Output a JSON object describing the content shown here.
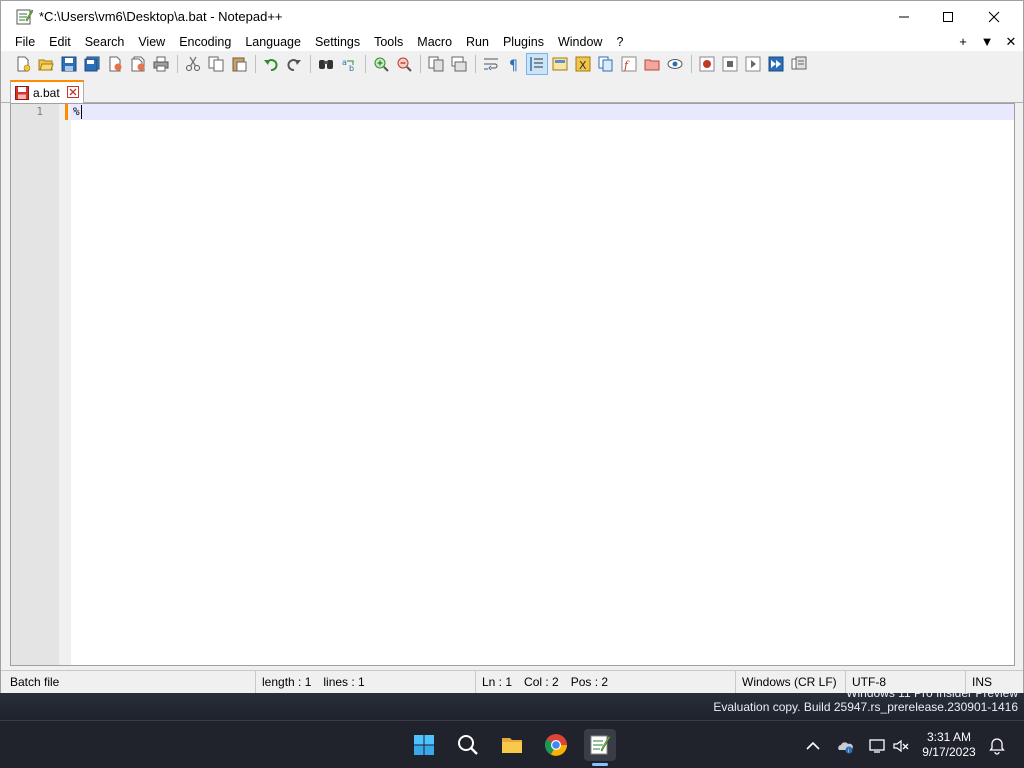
{
  "window": {
    "title": "*C:\\Users\\vm6\\Desktop\\a.bat - Notepad++",
    "controls": {
      "minimize": "─",
      "maximize": "☐",
      "close": "✕"
    }
  },
  "menubar": {
    "items": [
      "File",
      "Edit",
      "Search",
      "View",
      "Encoding",
      "Language",
      "Settings",
      "Tools",
      "Macro",
      "Run",
      "Plugins",
      "Window",
      "?"
    ],
    "right": [
      "+",
      "▼",
      "✕"
    ]
  },
  "tabs": [
    {
      "label": "a.bat",
      "modified": true,
      "active": true
    }
  ],
  "editor": {
    "lines": [
      {
        "number": "1",
        "text": "%"
      }
    ]
  },
  "statusbar": {
    "file_type": "Batch file",
    "length": "length : 1",
    "lines": "lines : 1",
    "ln": "Ln : 1",
    "col": "Col : 2",
    "pos": "Pos : 2",
    "eol": "Windows (CR LF)",
    "encoding": "UTF-8",
    "mode": "INS"
  },
  "watermark": {
    "line1": "Windows 11 Pro Insider Preview",
    "line2": "Evaluation copy. Build 25947.rs_prerelease.230901-1416"
  },
  "taskbar": {
    "apps": [
      "start-icon",
      "search-icon",
      "file-explorer-icon",
      "chrome-icon",
      "notepadpp-icon"
    ],
    "tray": [
      "chevron-up-icon",
      "onedrive-icon",
      "network-icon",
      "volume-muted-icon",
      "notification-icon"
    ],
    "time": "3:31 AM",
    "date": "9/17/2023"
  },
  "colors": {
    "accent_tab": "#ff8c00",
    "current_line": "#e8e8ff",
    "taskbar_bg": "#20232b"
  }
}
